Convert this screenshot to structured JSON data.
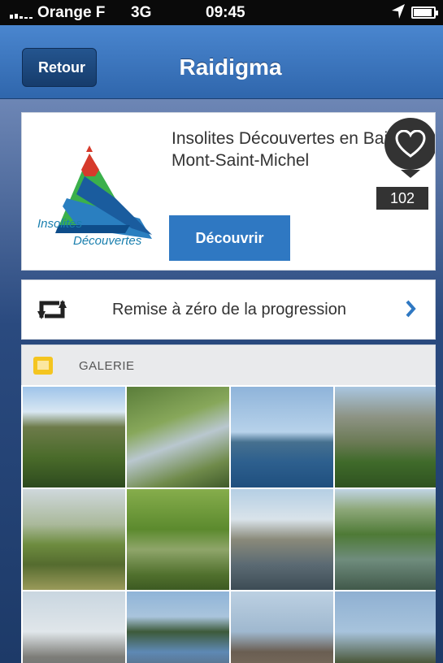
{
  "status_bar": {
    "carrier": "Orange F",
    "network": "3G",
    "time": "09:45"
  },
  "nav": {
    "back_label": "Retour",
    "title": "Raidigma"
  },
  "card": {
    "logo_text_line1": "Insolites",
    "logo_text_line2": "Découvertes",
    "title": "Insolites Découvertes en Baie du Mont-Saint-Michel",
    "discover_label": "Découvrir",
    "like_count": "102"
  },
  "reset": {
    "label": "Remise à zéro de la progression"
  },
  "gallery": {
    "title": "GALERIE",
    "tile_count": 12
  },
  "colors": {
    "accent": "#2f78c2",
    "nav": "#3b74bd",
    "heart": "#333333"
  },
  "icons": [
    "signal-icon",
    "location-arrow-icon",
    "battery-icon",
    "heart-icon",
    "repeat-icon",
    "chevron-right-icon",
    "gallery-icon"
  ]
}
